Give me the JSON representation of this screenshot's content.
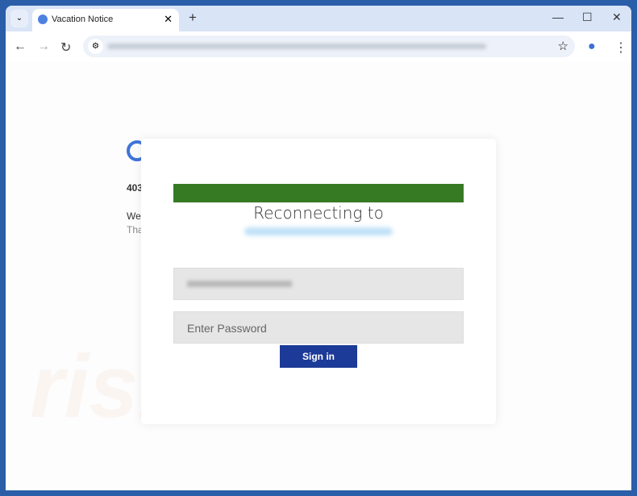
{
  "browser": {
    "tab_title": "Vacation Notice",
    "icons": [
      "chevron-down-icon",
      "close-icon",
      "plus-icon",
      "minimize-icon",
      "maximize-icon",
      "back-icon",
      "forward-icon",
      "reload-icon",
      "star-icon",
      "profile-icon",
      "menu-icon"
    ]
  },
  "background_page": {
    "code": "403",
    "line1": "We",
    "line2": "Tha"
  },
  "modal": {
    "heading": "Reconnecting to",
    "password_placeholder": "Enter Password",
    "signin_label": "Sign in",
    "bar_color": "#367b24",
    "button_color": "#1c3a97"
  },
  "watermark": "risk.com"
}
